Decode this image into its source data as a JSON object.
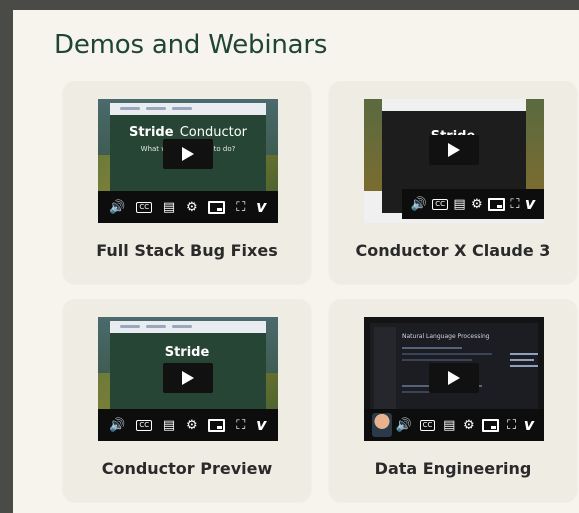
{
  "section": {
    "title": "Demos and Webinars"
  },
  "thumbnail_text": {
    "brand": "Stride",
    "brand_suffix": "Conductor",
    "prompt": "What would you like to do?",
    "code_heading": "Natural Language Processing"
  },
  "player_controls": {
    "volume_icon": "volume-icon",
    "cc_label": "CC",
    "transcript_icon": "transcript-icon",
    "settings_icon": "gear-icon",
    "pip_icon": "picture-in-picture-icon",
    "fullscreen_icon": "fullscreen-icon",
    "vimeo_label": "v"
  },
  "cards": [
    {
      "title": "Full Stack Bug Fixes"
    },
    {
      "title": "Conductor X Claude 3"
    },
    {
      "title": "Conductor Preview"
    },
    {
      "title": "Data Engineering"
    }
  ],
  "colors": {
    "background_frame": "#4a4a47",
    "panel": "#f7f4ed",
    "card": "#efece4",
    "title": "#1f4534",
    "player_bar": "#0d0d0d"
  }
}
